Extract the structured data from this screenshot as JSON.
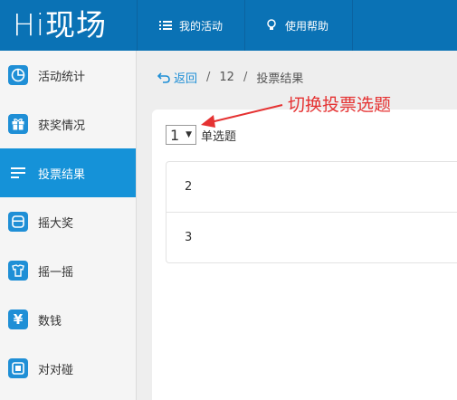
{
  "header": {
    "logo": "Hi现场",
    "nav": [
      {
        "label": "我的活动",
        "icon": "list-icon"
      },
      {
        "label": "使用帮助",
        "icon": "lightbulb-icon"
      }
    ]
  },
  "sidebar": {
    "items": [
      {
        "label": "活动统计",
        "icon": "pie-chart-icon",
        "active": false
      },
      {
        "label": "获奖情况",
        "icon": "gift-icon",
        "active": false
      },
      {
        "label": "投票结果",
        "icon": "bar-list-icon",
        "active": true
      },
      {
        "label": "摇大奖",
        "icon": "machine-icon",
        "active": false
      },
      {
        "label": "摇一摇",
        "icon": "shirt-icon",
        "active": false
      },
      {
        "label": "数钱",
        "icon": "yen-icon",
        "active": false
      },
      {
        "label": "对对碰",
        "icon": "match-icon",
        "active": false
      }
    ]
  },
  "breadcrumb": {
    "back": "返回",
    "sep": "/",
    "item1": "12",
    "current": "投票结果"
  },
  "selector": {
    "value": "1",
    "label": "单选题"
  },
  "options": [
    "2",
    "3"
  ],
  "annotation": "切换投票选题",
  "colors": {
    "brand": "#0a72b5",
    "active": "#1592d8",
    "annotation": "#e53232"
  }
}
